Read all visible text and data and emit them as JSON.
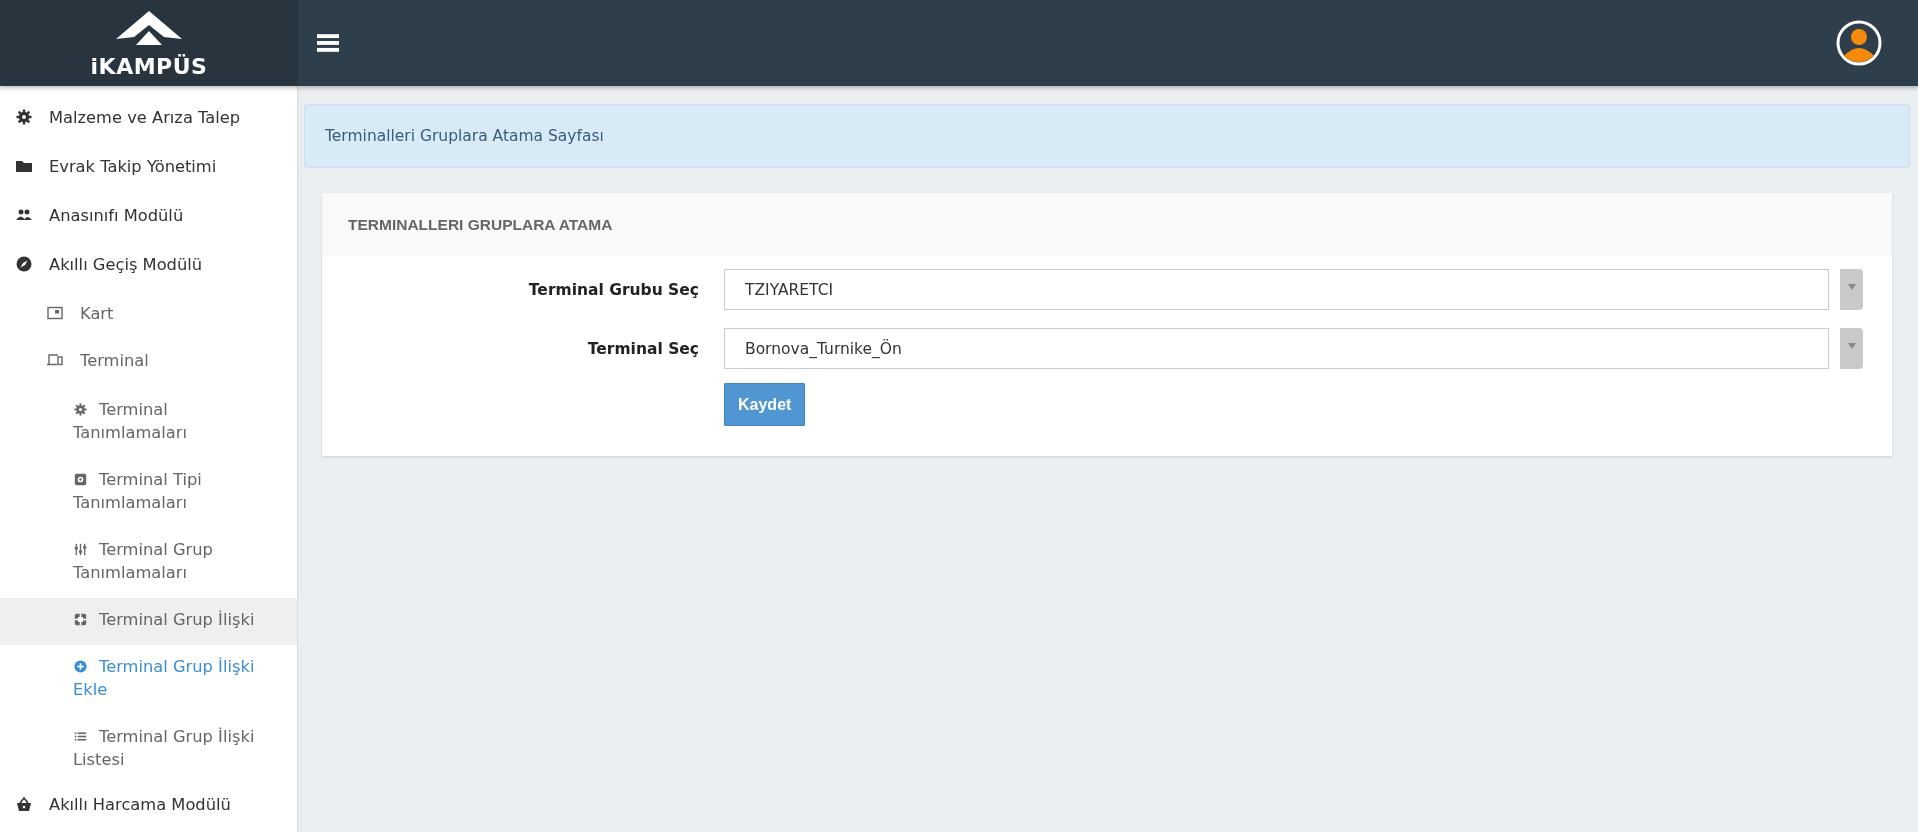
{
  "header": {
    "logo": "iKAMPÜS"
  },
  "sidebar": {
    "items": [
      {
        "label": "Malzeme ve Arıza Talep",
        "selected": false,
        "active": false
      },
      {
        "label": "Evrak Takip Yönetimi",
        "selected": false,
        "active": false
      },
      {
        "label": "Anasınıfı Modülü",
        "selected": false,
        "active": false
      },
      {
        "label": "Akıllı Geçiş Modülü",
        "selected": false,
        "active": false,
        "children": [
          {
            "label": "Kart",
            "selected": false,
            "active": false
          },
          {
            "label": "Terminal",
            "selected": false,
            "active": false,
            "children": [
              {
                "label": "Terminal Tanımlamaları",
                "selected": false,
                "active": false
              },
              {
                "label": "Terminal Tipi Tanımlamaları",
                "selected": false,
                "active": false
              },
              {
                "label": "Terminal Grup Tanımlamaları",
                "selected": false,
                "active": false
              },
              {
                "label": "Terminal Grup İlişki",
                "selected": true,
                "active": false
              },
              {
                "label": "Terminal Grup İlişki Ekle",
                "selected": false,
                "active": true
              },
              {
                "label": "Terminal Grup İlişki Listesi",
                "selected": false,
                "active": false
              }
            ]
          }
        ]
      },
      {
        "label": "Akıllı Harcama Modülü",
        "selected": false,
        "active": false
      }
    ]
  },
  "alert": "Terminalleri Gruplara Atama Sayfası",
  "card": {
    "title": "TERMINALLERI GRUPLARA ATAMA",
    "fields": [
      {
        "label": "Terminal Grubu Seç",
        "value": "TZIYARETCI"
      },
      {
        "label": "Terminal Seç",
        "value": "Bornova_Turnike_Ön"
      }
    ],
    "button": "Kaydet"
  }
}
